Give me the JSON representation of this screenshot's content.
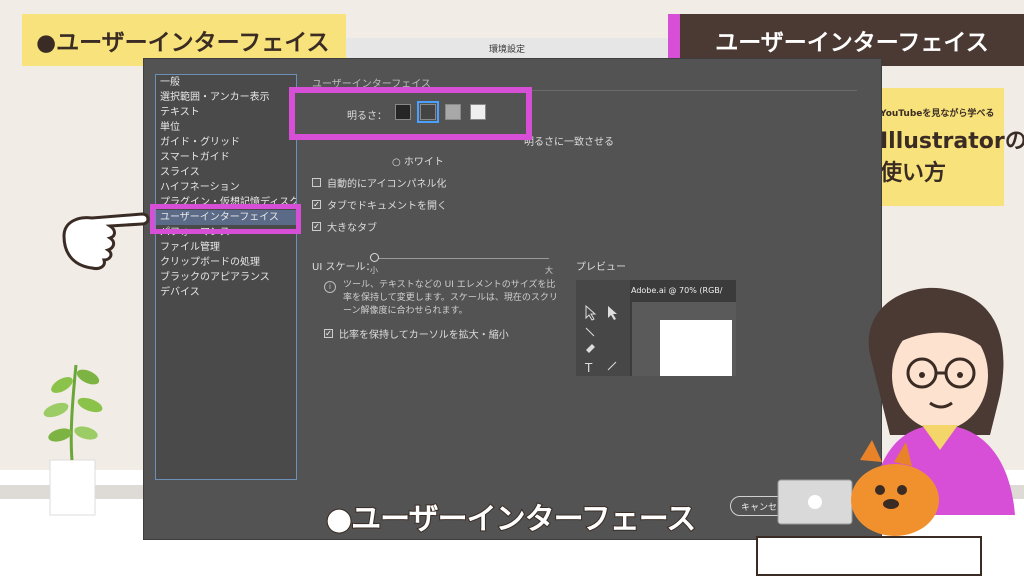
{
  "overlay": {
    "top_left_label": "●ユーザーインターフェイス",
    "top_right_label": "ユーザーインターフェイス",
    "caption": "●ユーザーインターフェース"
  },
  "dialog": {
    "title": "環境設定",
    "sidebar_items": [
      {
        "label": "一般"
      },
      {
        "label": "選択範囲・アンカー表示"
      },
      {
        "label": "テキスト"
      },
      {
        "label": "単位"
      },
      {
        "label": "ガイド・グリッド"
      },
      {
        "label": "スマートガイド"
      },
      {
        "label": "スライス"
      },
      {
        "label": "ハイフネーション"
      },
      {
        "label": "プラグイン・仮想記憶ディスク"
      },
      {
        "label": "ユーザーインターフェイス",
        "selected": true
      },
      {
        "label": "パフォーマンス"
      },
      {
        "label": "ファイル管理"
      },
      {
        "label": "クリップボードの処理"
      },
      {
        "label": "ブラックのアピアランス"
      },
      {
        "label": "デバイス"
      }
    ],
    "section_title": "ユーザーインターフェイス",
    "brightness_label": "明るさ：",
    "brightness_swatches": [
      "#262626",
      "#444444",
      "#a8a8a8",
      "#eeeeee"
    ],
    "brightness_selected_index": 1,
    "canvas_match_label": "明るさに一致させる",
    "white_radio_label": "○ ホワイト",
    "checkbox_auto_collapse": "自動的にアイコンパネル化",
    "checkbox_open_tabs": "タブでドキュメントを開く",
    "checkbox_large_tabs": "大きなタブ",
    "ui_scale_label": "UI スケール：",
    "scale_small": "小",
    "scale_large": "大",
    "info_text": "ツール、テキストなどの UI エレメントのサイズを比率を保持して変更します。スケールは、現在のスクリーン解像度に合わせられます。",
    "checkbox_scale_cursor": "比率を保持してカーソルを拡大・縮小",
    "preview_label": "プレビュー",
    "preview_tab": "Adobe.ai @ 70% (RGB/",
    "cancel_label": "キャンセル"
  },
  "promo": {
    "small": "YouTubeを見ながら学べる",
    "title_line1": "Illustratorの",
    "title_line2": "使い方"
  },
  "colors": {
    "highlight": "#d64fd6",
    "yellow": "#f7e27b",
    "dark_brown": "#4b3a33",
    "dialog_bg": "#535353"
  }
}
